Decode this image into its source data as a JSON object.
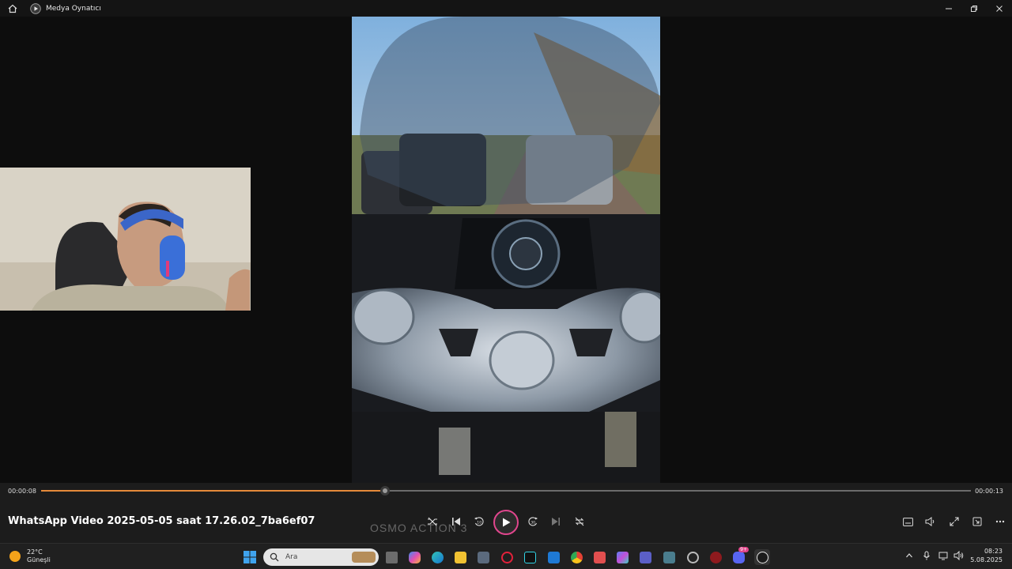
{
  "window": {
    "app_title": "Medya Oynatıcı"
  },
  "player": {
    "current_time": "00:00:08",
    "total_time": "00:00:13",
    "progress": 0.37,
    "video_title": "WhatsApp Video 2025-05-05 saat 17.26.02_7ba6ef07",
    "watermark": "OSMO ACTION 3"
  },
  "taskbar": {
    "weather_temp": "22°C",
    "weather_desc": "Güneşli",
    "search_placeholder": "Ara",
    "notification_badge": "9+",
    "time": "08:23",
    "date": "5.08.2025"
  },
  "colors": {
    "accent": "#e58a3a",
    "play_ring": "#e0468d"
  }
}
